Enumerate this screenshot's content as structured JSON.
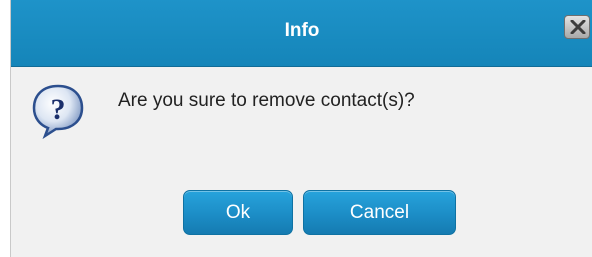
{
  "dialog": {
    "title": "Info",
    "message": "Are you sure to remove contact(s)?",
    "close_icon": "close-icon",
    "message_icon": "question-icon"
  },
  "buttons": {
    "ok_label": "Ok",
    "cancel_label": "Cancel"
  },
  "colors": {
    "titlebar": "#1a8cc2",
    "button": "#1c8dc6",
    "background": "#f1f1f1"
  }
}
